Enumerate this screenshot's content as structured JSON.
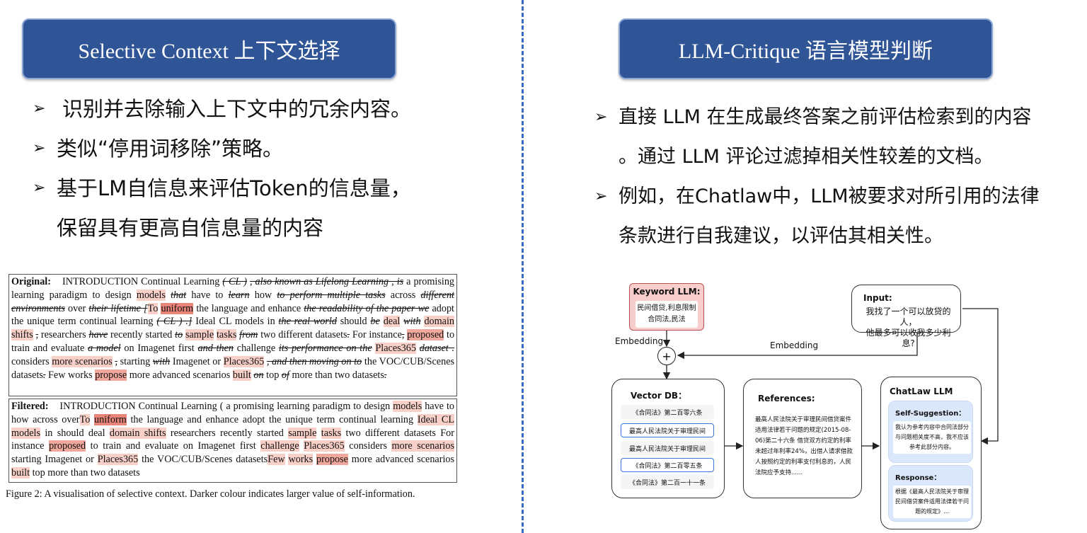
{
  "left": {
    "title": "Selective Context 上下文选择",
    "bullets": [
      "识别并去除输入上下文中的冗余内容。",
      "类似“停用词移除”策略。",
      "基于LM自信息来评估Token的信息量，",
      "保留具有更高自信息量的内容"
    ],
    "figure": {
      "original_label": "Original:",
      "filtered_label": "Filtered:",
      "caption": "Figure 2: A visualisation of selective context. Darker colour indicates larger value of self-information."
    }
  },
  "right": {
    "title": "LLM-Critique 语言模型判断",
    "bullets": [
      "直接 LLM 在生成最终答案之前评估检索到的内容",
      "。通过 LLM 评论过滤掉相关性较差的文档。",
      "例如，在Chatlaw中，LLM被要求对所引用的法律",
      "条款进行自我建议，以评估其相关性。"
    ],
    "diagram": {
      "keyword_llm_title": "Keyword LLM:",
      "keyword_llm_text1": "民间借贷,利息限制",
      "keyword_llm_text2": "合同法,民法",
      "input_title": "Input:",
      "input_text1": "我找了一个可以放贷的人，",
      "input_text2": "他最多可以收我多少利息?",
      "embedding_left": "Embedding",
      "embedding_right": "Embedding",
      "plus": "+",
      "vector_db_title": "Vector DB：",
      "vector_items": [
        "《合同法》第二百零六条",
        "最高人民法院关于审理民间",
        "最高人民法院关于审理民间",
        "《合同法》第二百零五条",
        "《合同法》第二百一十一条"
      ],
      "references_title": "References:",
      "references_text": "最高人民法院关于审理民间借贷案件适用法律若干问题的规定(2015-08-06)第二十六条 借贷双方约定的利率未超过年利率24%，出借人请求借款人按照约定的利率支付利息的，人民法院应予支持......",
      "chatlaw_title": "ChatLaw LLM",
      "self_suggestion_title": "Self-Suggestion：",
      "self_suggestion_text": "我认为参考内容中合同法部分与问题相关度不高，我不应该参考此部分内容。",
      "response_title": "Response：",
      "response_text": "根据《最高人民法院关于审理民间借贷案件适用法律若干问题的规定》..."
    }
  }
}
